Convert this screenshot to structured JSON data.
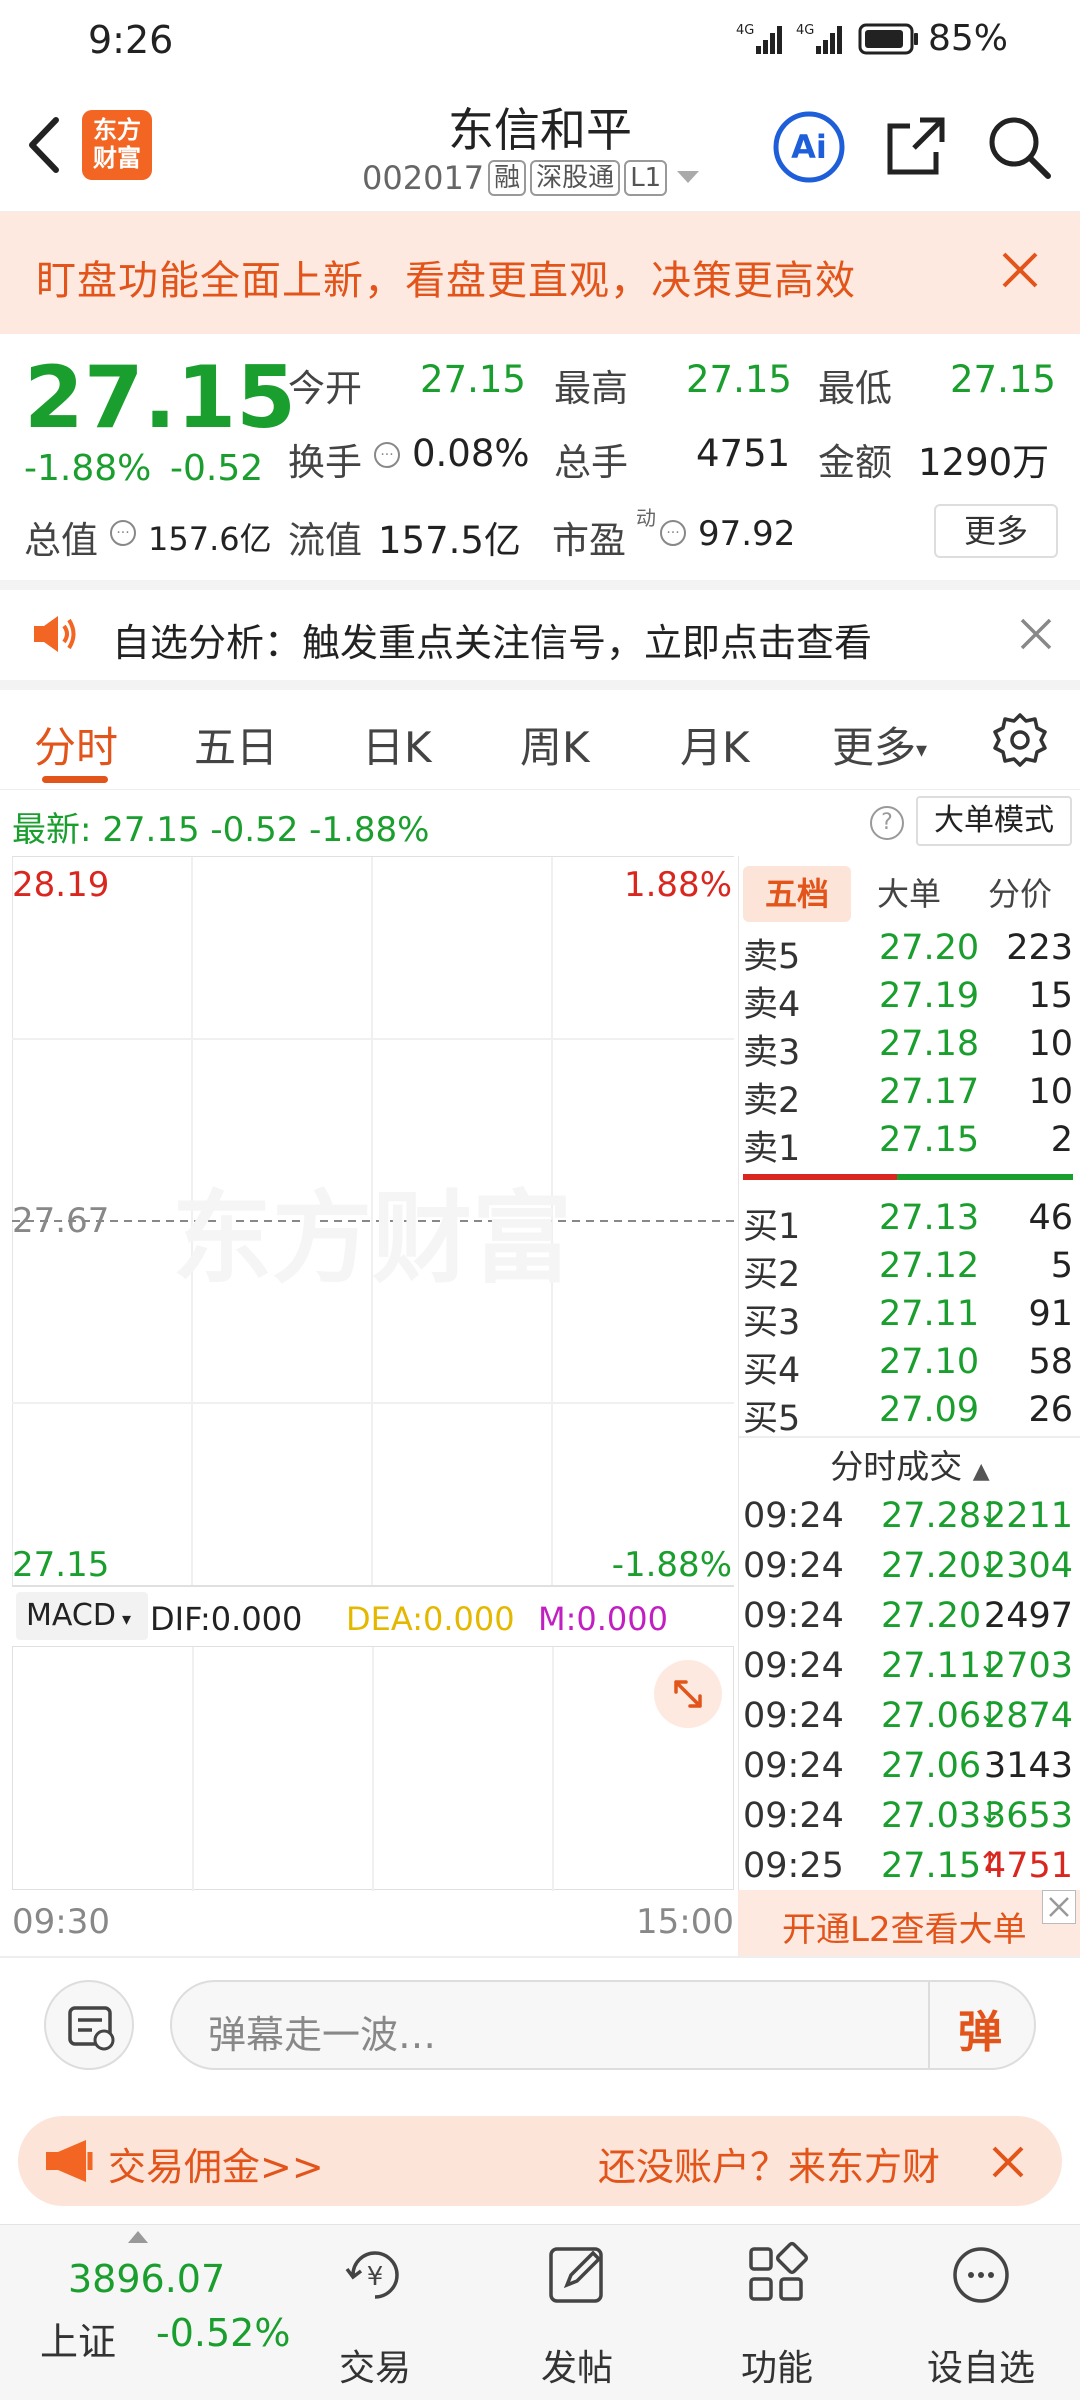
{
  "status_bar": {
    "time": "9:26",
    "signal1": "4G",
    "signal2": "4G",
    "battery": "85%"
  },
  "header": {
    "name": "东信和平",
    "code": "002017",
    "tags": [
      "融",
      "深股通",
      "L1"
    ],
    "logo_text": [
      "东方",
      "财富"
    ],
    "ai_label": "Ai"
  },
  "banner": {
    "text": "盯盘功能全面上新，看盘更直观，决策更高效"
  },
  "quote": {
    "price": "27.15",
    "change_pct": "-1.88%",
    "change": "-0.52",
    "open_label": "今开",
    "open": "27.15",
    "high_label": "最高",
    "high": "27.15",
    "low_label": "最低",
    "low": "27.15",
    "turnover_label": "换手",
    "turnover": "0.08%",
    "volume_label": "总手",
    "volume": "4751",
    "amount_label": "金额",
    "amount": "1290万",
    "mktcap_label": "总值",
    "mktcap": "157.6亿",
    "float_label": "流值",
    "float": "157.5亿",
    "pe_label": "市盈",
    "pe_sup": "动",
    "pe": "97.92",
    "more": "更多"
  },
  "alert": {
    "text": "自选分析：触发重点关注信号，立即点击查看"
  },
  "tabs": {
    "items": [
      "分时",
      "五日",
      "日K",
      "周K",
      "月K",
      "更多"
    ],
    "active": 0
  },
  "latest": {
    "text": "最新:  27.15  -0.52  -1.88%",
    "mode": "大单模式"
  },
  "chart": {
    "high": "28.19",
    "high_pct": "1.88%",
    "mid": "27.67",
    "low": "27.15",
    "low_pct": "-1.88%",
    "watermark": "东方财富",
    "time_start": "09:30",
    "time_end": "15:00"
  },
  "macd": {
    "select": "MACD",
    "dif": "DIF:0.000",
    "dea": "DEA:0.000",
    "m": "M:0.000"
  },
  "order_book": {
    "tabs": [
      "五档",
      "大单",
      "分价"
    ],
    "asks": [
      {
        "label": "卖5",
        "price": "27.20",
        "vol": "223"
      },
      {
        "label": "卖4",
        "price": "27.19",
        "vol": "15"
      },
      {
        "label": "卖3",
        "price": "27.18",
        "vol": "10"
      },
      {
        "label": "卖2",
        "price": "27.17",
        "vol": "10"
      },
      {
        "label": "卖1",
        "price": "27.15",
        "vol": "2"
      }
    ],
    "bids": [
      {
        "label": "买1",
        "price": "27.13",
        "vol": "46"
      },
      {
        "label": "买2",
        "price": "27.12",
        "vol": "5"
      },
      {
        "label": "买3",
        "price": "27.11",
        "vol": "91"
      },
      {
        "label": "买4",
        "price": "27.10",
        "vol": "58"
      },
      {
        "label": "买5",
        "price": "27.09",
        "vol": "26"
      }
    ],
    "trades_title": "分时成交",
    "trades": [
      {
        "time": "09:24",
        "price": "27.28",
        "arrow": "↓",
        "vol": "2211"
      },
      {
        "time": "09:24",
        "price": "27.20",
        "arrow": "↓",
        "vol": "2304"
      },
      {
        "time": "09:24",
        "price": "27.20",
        "arrow": "",
        "vol": "2497"
      },
      {
        "time": "09:24",
        "price": "27.11",
        "arrow": "↓",
        "vol": "2703"
      },
      {
        "time": "09:24",
        "price": "27.06",
        "arrow": "↓",
        "vol": "2874"
      },
      {
        "time": "09:24",
        "price": "27.06",
        "arrow": "",
        "vol": "3143"
      },
      {
        "time": "09:24",
        "price": "27.03",
        "arrow": "↓",
        "vol": "3653"
      },
      {
        "time": "09:25",
        "price": "27.15",
        "arrow": "↑",
        "vol": "4751"
      }
    ],
    "l2_text": "开通L2查看大单"
  },
  "danmaku": {
    "placeholder": "弹幕走一波…",
    "button": "弹"
  },
  "promo": {
    "left": "交易佣金>>",
    "right": "还没账户？来东方财"
  },
  "bottom_nav": {
    "index_value": "3896.07",
    "index_name": "上证",
    "index_change": "-0.52%",
    "items": [
      "交易",
      "发帖",
      "功能",
      "设自选"
    ]
  },
  "colors": {
    "up": "#d9271f",
    "down": "#1a9e2e",
    "accent": "#e2541a",
    "accent_bg": "#fde9df"
  }
}
